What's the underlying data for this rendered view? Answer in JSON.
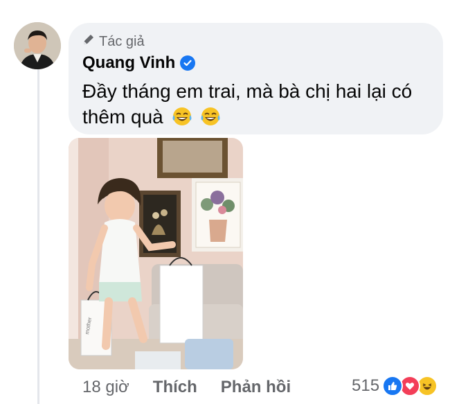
{
  "comment": {
    "badge_label": "Tác giả",
    "author": "Quang Vinh",
    "text": "Đầy tháng em trai, mà bà chị hai lại có thêm quà",
    "emojis": [
      "tears-of-joy-emoji",
      "tears-of-joy-emoji"
    ]
  },
  "photo": {
    "box_label": "mother",
    "description_icon": "child-with-gift-bags-photo"
  },
  "footer": {
    "time": "18 giờ",
    "like_label": "Thích",
    "reply_label": "Phản hồi",
    "reaction_count": "515",
    "reactions": [
      "like-icon",
      "love-icon",
      "haha-icon"
    ]
  },
  "colors": {
    "bubble": "#f0f2f5",
    "secondary_text": "#65676b",
    "verified": "#1877f2",
    "like": "#1877f2",
    "love": "#f33e58"
  }
}
